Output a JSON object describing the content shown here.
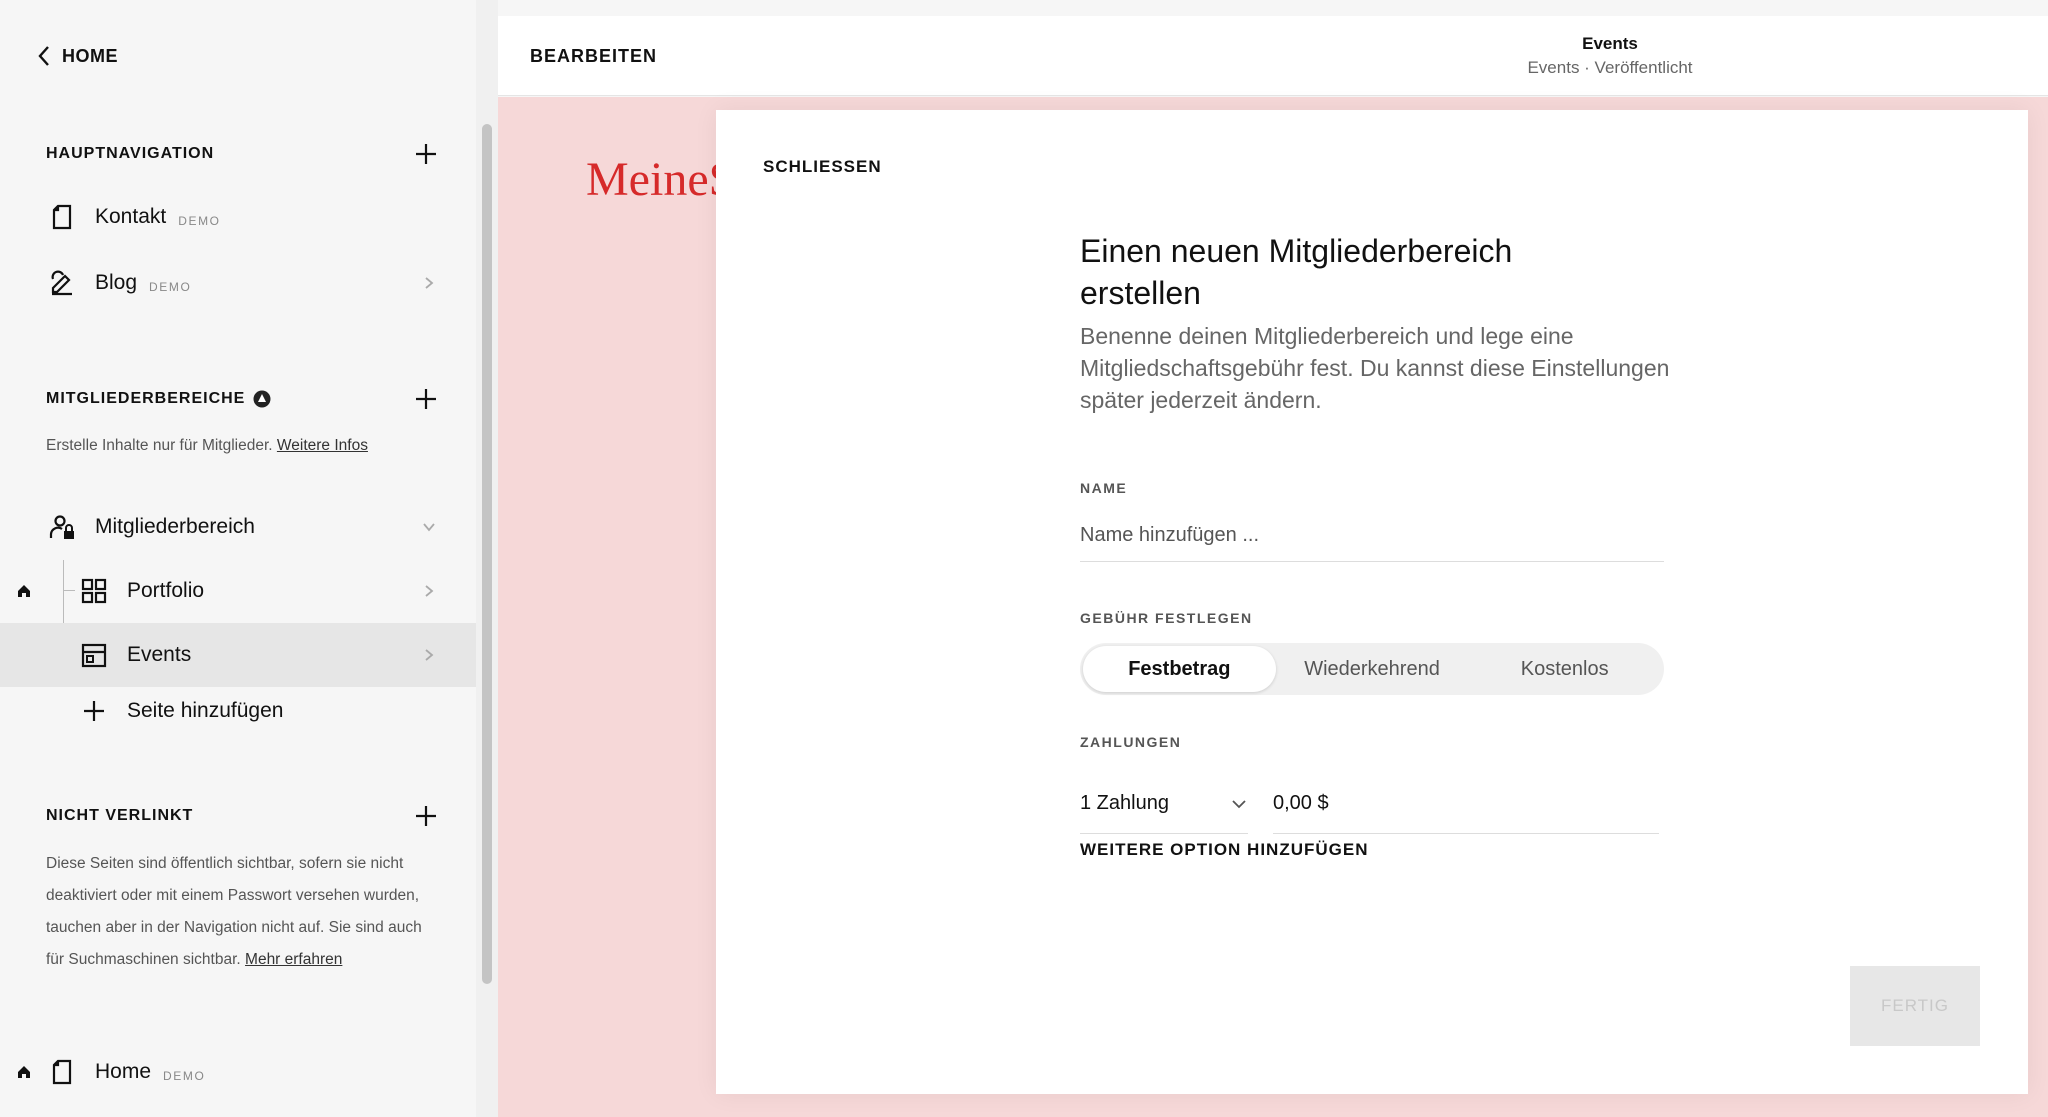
{
  "sidebar": {
    "back_label": "HOME",
    "main_nav": {
      "title": "HAUPTNAVIGATION",
      "items": [
        {
          "label": "Kontakt",
          "badge": "DEMO",
          "icon": "page-icon"
        },
        {
          "label": "Blog",
          "badge": "DEMO",
          "icon": "blog-icon"
        }
      ]
    },
    "members": {
      "title": "MITGLIEDERBEREICHE",
      "desc_text": "Erstelle Inhalte nur für Mitglieder.",
      "desc_link": "Weitere Infos",
      "area_label": "Mitgliederbereich",
      "children": [
        {
          "label": "Portfolio",
          "icon": "grid-icon"
        },
        {
          "label": "Events",
          "icon": "calendar-icon"
        }
      ],
      "add_page_label": "Seite hinzufügen"
    },
    "unlinked": {
      "title": "NICHT VERLINKT",
      "desc_text": "Diese Seiten sind öffentlich sichtbar, sofern sie nicht deaktiviert oder mit einem Passwort versehen wurden, tauchen aber in der Navigation nicht auf. Sie sind auch für Suchmaschinen sichtbar.",
      "desc_link": "Mehr erfahren",
      "items": [
        {
          "label": "Home",
          "badge": "DEMO",
          "icon": "page-icon"
        }
      ]
    }
  },
  "topbar": {
    "edit_label": "BEARBEITEN",
    "page_title": "Events",
    "page_status": "Events · Veröffentlicht"
  },
  "canvas": {
    "logo_text": "MeineSeite"
  },
  "modal": {
    "close_label": "SCHLIESSEN",
    "title": "Einen neuen Mitgliederbereich erstellen",
    "subtitle": "Benenne deinen Mitgliederbereich und lege eine Mitgliedschaftsgebühr fest. Du kannst diese Einstellungen später jederzeit ändern.",
    "name_label": "NAME",
    "name_placeholder": "Name hinzufügen ...",
    "fee_label": "GEBÜHR FESTLEGEN",
    "fee_options": [
      "Festbetrag",
      "Wiederkehrend",
      "Kostenlos"
    ],
    "payments_label": "ZAHLUNGEN",
    "payments_value": "1 Zahlung",
    "amount_value": "0,00 $",
    "add_option_label": "WEITERE OPTION HINZUFÜGEN",
    "done_label": "FERTIG"
  },
  "colors": {
    "canvas_bg": "#f6d8d8",
    "logo": "#d62a2a",
    "selected_row": "#e6e6e6"
  }
}
